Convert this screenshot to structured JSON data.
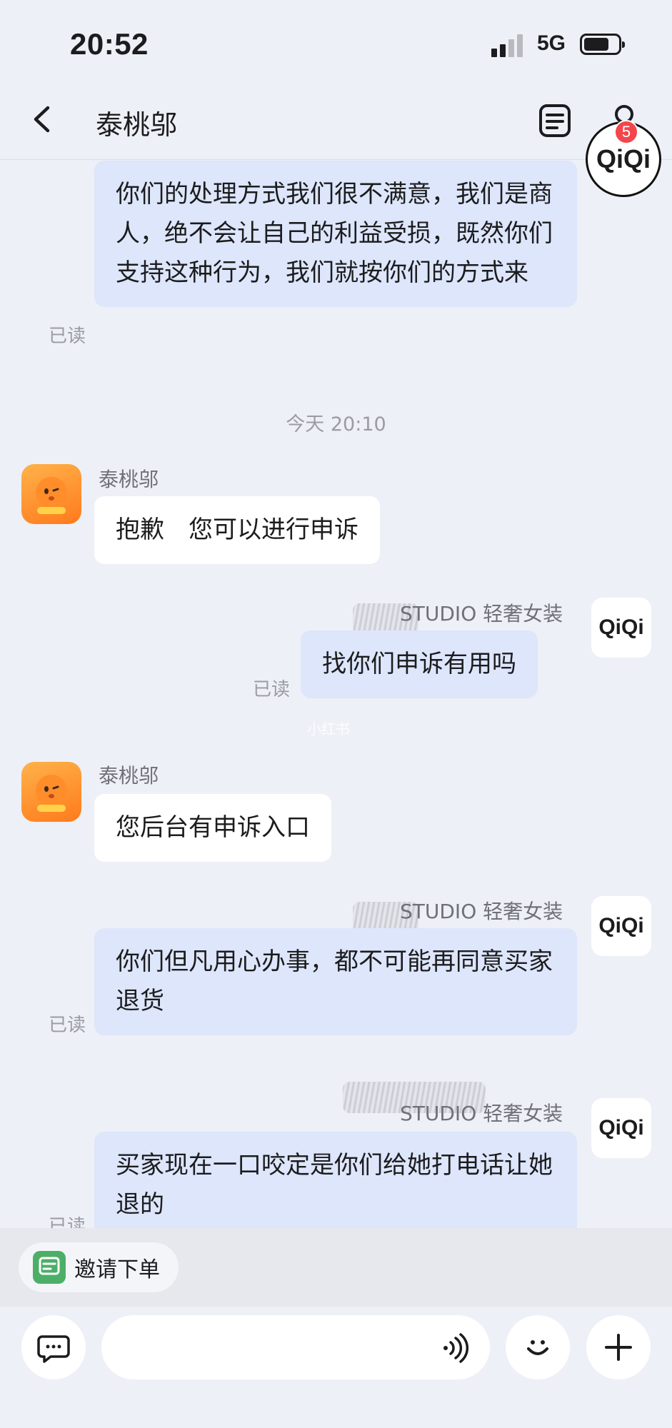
{
  "status_bar": {
    "time": "20:52",
    "network": "5G"
  },
  "nav": {
    "title": "泰桃邬"
  },
  "floating_badge": {
    "count": "5",
    "label": "QiQi"
  },
  "read_label": "已读",
  "shop_label": "STUDIO 轻奢女装",
  "merchant_avatar": "QiQi",
  "timestamp": "今天 20:10",
  "bot_name": "泰桃邬",
  "messages": {
    "m1": "你们的处理方式我们很不满意，我们是商人，绝不会让自己的利益受损，既然你们支持这种行为，我们就按你们的方式来",
    "m2": "抱歉　您可以进行申诉",
    "m3": "找你们申诉有用吗",
    "m4": "您后台有申诉入口",
    "m5": "你们但凡用心办事，都不可能再同意买家退货",
    "m6": "买家现在一口咬定是你们给她打电话让她退的"
  },
  "watermark": "小红书",
  "action_row": {
    "invite_label": "邀请下单"
  },
  "input": {
    "placeholder": ""
  }
}
